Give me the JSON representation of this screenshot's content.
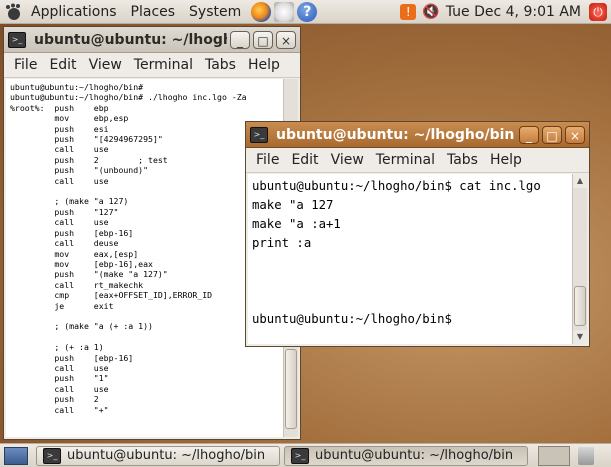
{
  "top_panel": {
    "menus": [
      "Applications",
      "Places",
      "System"
    ],
    "clock": "Tue Dec  4,  9:01 AM"
  },
  "icons": {
    "help_glyph": "?",
    "minimize_glyph": "_",
    "maximize_glyph": "□",
    "close_glyph": "×"
  },
  "window_back": {
    "title": "ubuntu@ubuntu: ~/lhogho/bin",
    "menu": [
      "File",
      "Edit",
      "View",
      "Terminal",
      "Tabs",
      "Help"
    ],
    "content": "ubuntu@ubuntu:~/lhogho/bin#\nubuntu@ubuntu:~/lhogho/bin# ./lhogho inc.lgo -Za\n%root%:  push    ebp\n         mov     ebp,esp\n         push    esi\n         push    \"[4294967295]\"\n         call    use\n         push    2        ; test\n         push    \"(unbound)\"\n         call    use\n\n         ; (make \"a 127)\n         push    \"127\"\n         call    use\n         push    [ebp-16]\n         call    deuse\n         mov     eax,[esp]\n         mov     [ebp-16],eax\n         push    \"(make \"a 127)\"\n         call    rt_makechk\n         cmp     [eax+OFFSET_ID],ERROR_ID\n         je      exit\n\n         ; (make \"a (+ :a 1))\n\n         ; (+ :a 1)\n         push    [ebp-16]\n         call    use\n         push    \"1\"\n         call    use\n         push    2\n         call    \"+\""
  },
  "window_front": {
    "title": "ubuntu@ubuntu: ~/lhogho/bin",
    "menu": [
      "File",
      "Edit",
      "View",
      "Terminal",
      "Tabs",
      "Help"
    ],
    "content": "ubuntu@ubuntu:~/lhogho/bin$ cat inc.lgo\nmake \"a 127\nmake \"a :a+1\nprint :a\n\n\n\nubuntu@ubuntu:~/lhogho/bin$"
  },
  "taskbar": {
    "tasks": [
      "ubuntu@ubuntu: ~/lhogho/bin",
      "ubuntu@ubuntu: ~/lhogho/bin"
    ]
  },
  "colors": {
    "accent_titlebar": "#b97b3f",
    "desktop": "#a4713f"
  }
}
